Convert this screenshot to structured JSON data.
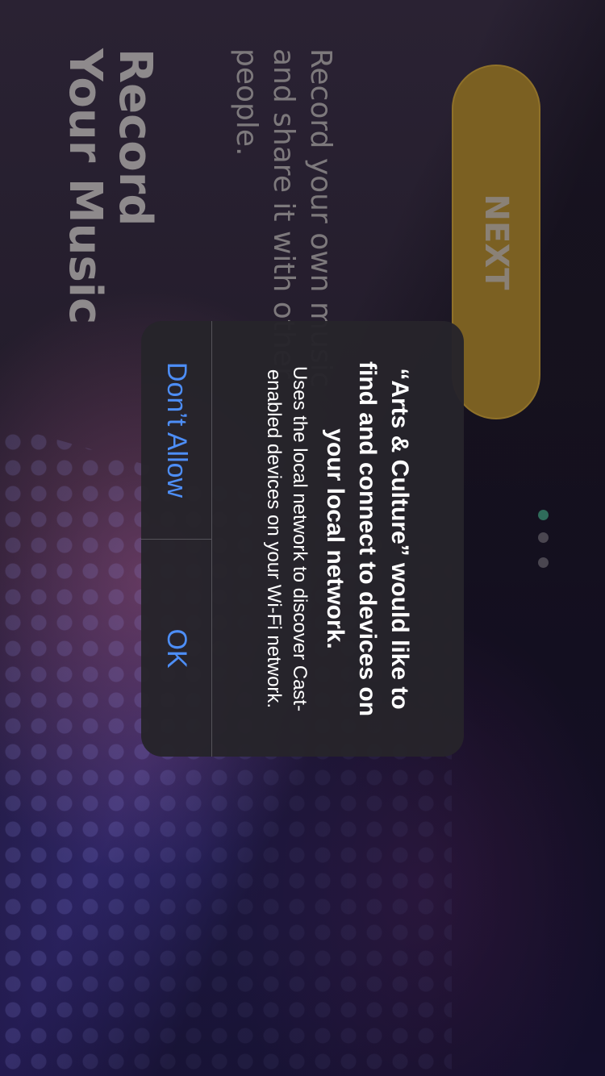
{
  "onboarding": {
    "title": "Record\nYour Music",
    "description": "Record your own music and share it with other people.",
    "next_label": "NEXT",
    "page_count": 3,
    "active_page": 1
  },
  "alert": {
    "title": "“Arts & Culture” would like to find and connect to devices on your local network.",
    "message": "Uses the local network to discover Cast-enabled devices on your Wi-Fi network.",
    "deny_label": "Don’t Allow",
    "ok_label": "OK"
  },
  "colors": {
    "accent_button": "#7b6022",
    "alert_link": "#4d8ef7",
    "active_dot": "#2f6c5b"
  }
}
